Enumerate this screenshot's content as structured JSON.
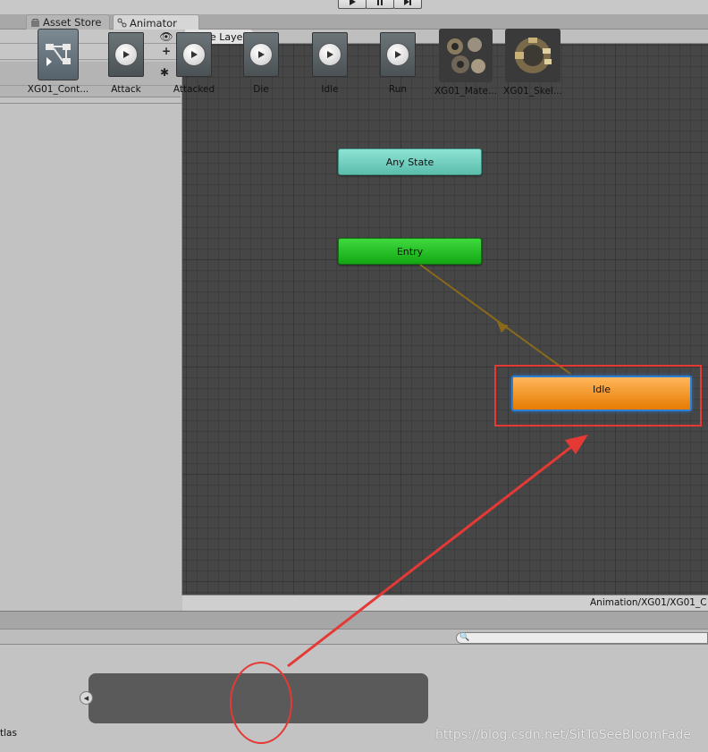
{
  "tabs": [
    {
      "label": "Asset Store",
      "icon": "asset-store-icon",
      "active": false
    },
    {
      "label": "Animator",
      "icon": "animator-icon",
      "active": true
    }
  ],
  "playbar": {
    "play": "play-icon",
    "pause": "pause-icon",
    "step": "step-icon"
  },
  "breadcrumb": {
    "label": "Base Layer"
  },
  "nodes": {
    "any_state": {
      "label": "Any State",
      "color": "#6fd1c0"
    },
    "entry": {
      "label": "Entry",
      "color": "#23c023"
    },
    "idle": {
      "label": "Idle",
      "color": "#f29624"
    }
  },
  "graph": {
    "controller_path": "Animation/XG01/XG01_C"
  },
  "assets": {
    "left_cut_label": "tlas",
    "controller": {
      "label": "XG01_Cont..."
    },
    "clips": [
      {
        "label": "Attack"
      },
      {
        "label": "Attacked"
      },
      {
        "label": "Die"
      },
      {
        "label": "Idle"
      },
      {
        "label": "Run"
      }
    ],
    "material": {
      "label": "XG01_Mate..."
    },
    "skeleton": {
      "label": "XG01_Skel..."
    }
  },
  "watermark": "https://blog.csdn.net/SitToSeeBloomFade",
  "colors": {
    "highlight_red": "#e53935",
    "transition_arrow": "#8a6a1a"
  }
}
